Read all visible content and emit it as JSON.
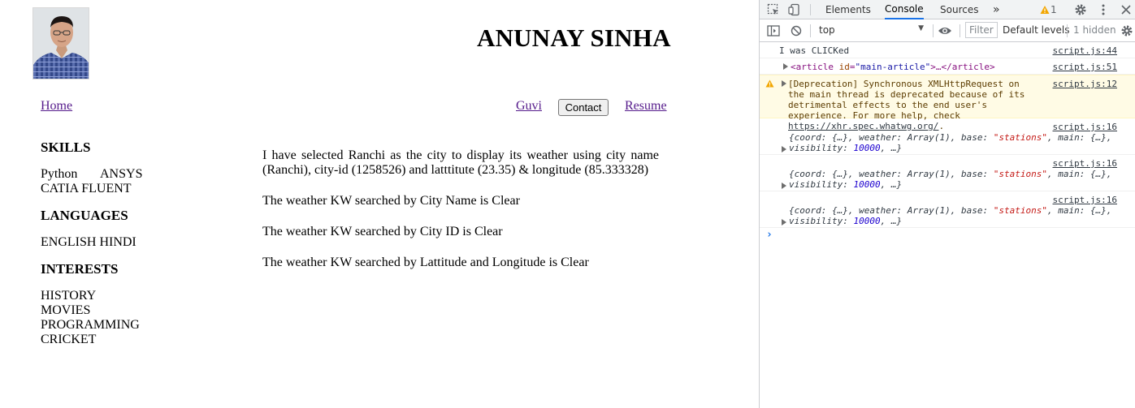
{
  "page": {
    "title": "ANUNAY SINHA",
    "nav": {
      "home": "Home",
      "guvi": "Guvi",
      "contact": "Contact",
      "resume": "Resume"
    },
    "sidebar": {
      "skills_heading": "SKILLS",
      "skills_row1": [
        "Python",
        "ANSYS"
      ],
      "skills_row2": "CATIA FLUENT",
      "languages_heading": "LANGUAGES",
      "languages": "ENGLISH HINDI",
      "interests_heading": "INTERESTS",
      "interests": [
        "HISTORY",
        "MOVIES",
        "PROGRAMMING",
        "CRICKET"
      ]
    },
    "main": {
      "intro": "I have selected Ranchi as the city to display its weather using city name (Ranchi), city-id (1258526) and latttitute (23.35) & longitude (85.333328)",
      "by_name": "The weather KW searched by City Name is Clear",
      "by_id": "The weather KW searched by City ID is Clear",
      "by_coords": "The weather KW searched by Lattitude and Longitude is Clear"
    }
  },
  "devtools": {
    "tabs": [
      "Elements",
      "Console",
      "Sources"
    ],
    "active_tab": "Console",
    "more_tabs": "»",
    "warning_count": "1",
    "context": "top",
    "filter_placeholder": "Filter",
    "levels": "Default levels",
    "hidden": "1 hidden",
    "messages": [
      {
        "text": "I was CLICKed",
        "source": "script.js:44"
      },
      {
        "text_tag_open": "<article",
        "attr_name": "id",
        "attr_value": "\"main-article\"",
        "text_tag_rest": ">…</article>",
        "source": "script.js:51"
      },
      {
        "warning": "[Deprecation] Synchronous XMLHttpRequest on the main thread is deprecated because of its detrimental effects to the end user's experience. For more help, check ",
        "link": "https://xhr.spec.whatwg.org/",
        "tail": ".",
        "source": "script.js:12"
      },
      {
        "source": "script.js:16"
      },
      {
        "source": "script.js:16"
      },
      {
        "source": "script.js:16"
      }
    ],
    "object_preview": {
      "coord": "coord",
      "coord_val": "{…}",
      "weather": "weather",
      "weather_val": "Array(1)",
      "base": "base",
      "base_val": "\"stations\"",
      "main": "main",
      "main_val": "{…}",
      "visibility": "visibility",
      "visibility_val": "10000"
    },
    "prompt": "›"
  },
  "colors": {
    "link_visited": "#551a8b",
    "devtools_accent": "#1a73e8",
    "warning_bg": "#fffbe5",
    "string": "#c41a16",
    "number": "#1c00cf"
  }
}
